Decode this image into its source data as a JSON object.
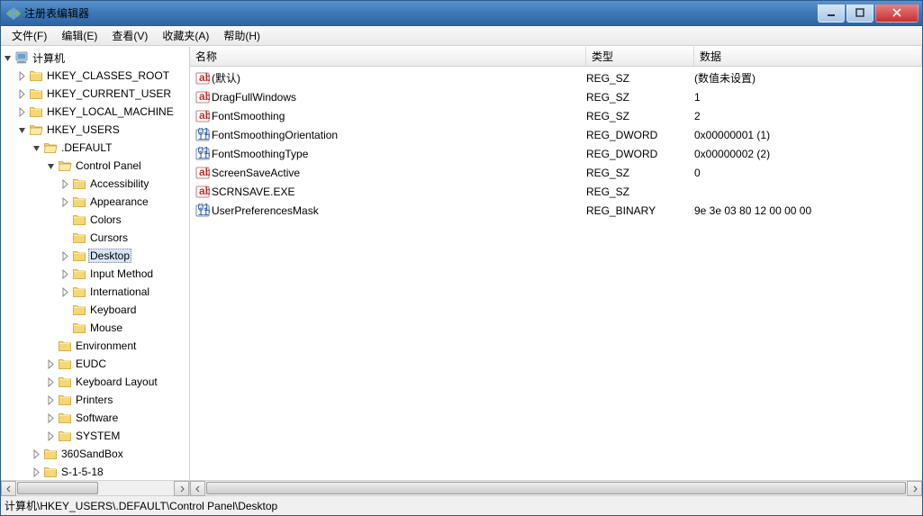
{
  "window": {
    "title": "注册表编辑器"
  },
  "menu": {
    "file": "文件(F)",
    "edit": "编辑(E)",
    "view": "查看(V)",
    "fav": "收藏夹(A)",
    "help": "帮助(H)"
  },
  "tree": {
    "root": "计算机",
    "hkcr": "HKEY_CLASSES_ROOT",
    "hkcu": "HKEY_CURRENT_USER",
    "hklm": "HKEY_LOCAL_MACHINE",
    "hku": "HKEY_USERS",
    "default": ".DEFAULT",
    "cpl": "Control Panel",
    "cpl_items": {
      "accessibility": "Accessibility",
      "appearance": "Appearance",
      "colors": "Colors",
      "cursors": "Cursors",
      "desktop": "Desktop",
      "input": "Input Method",
      "intl": "International",
      "keyboard": "Keyboard",
      "mouse": "Mouse"
    },
    "def_items": {
      "env": "Environment",
      "eudc": "EUDC",
      "kbl": "Keyboard Layout",
      "printers": "Printers",
      "software": "Software",
      "system": "SYSTEM"
    },
    "hku_items": {
      "sandbox": "360SandBox",
      "s1518": "S-1-5-18"
    }
  },
  "list": {
    "columns": {
      "name": "名称",
      "type": "类型",
      "data": "数据"
    },
    "rows": [
      {
        "icon": "sz",
        "name": "(默认)",
        "type": "REG_SZ",
        "data": "(数值未设置)"
      },
      {
        "icon": "sz",
        "name": "DragFullWindows",
        "type": "REG_SZ",
        "data": "1"
      },
      {
        "icon": "sz",
        "name": "FontSmoothing",
        "type": "REG_SZ",
        "data": "2"
      },
      {
        "icon": "bin",
        "name": "FontSmoothingOrientation",
        "type": "REG_DWORD",
        "data": "0x00000001 (1)"
      },
      {
        "icon": "bin",
        "name": "FontSmoothingType",
        "type": "REG_DWORD",
        "data": "0x00000002 (2)"
      },
      {
        "icon": "sz",
        "name": "ScreenSaveActive",
        "type": "REG_SZ",
        "data": "0"
      },
      {
        "icon": "sz",
        "name": "SCRNSAVE.EXE",
        "type": "REG_SZ",
        "data": ""
      },
      {
        "icon": "bin",
        "name": "UserPreferencesMask",
        "type": "REG_BINARY",
        "data": "9e 3e 03 80 12 00 00 00"
      }
    ]
  },
  "status": {
    "path": "计算机\\HKEY_USERS\\.DEFAULT\\Control Panel\\Desktop"
  }
}
